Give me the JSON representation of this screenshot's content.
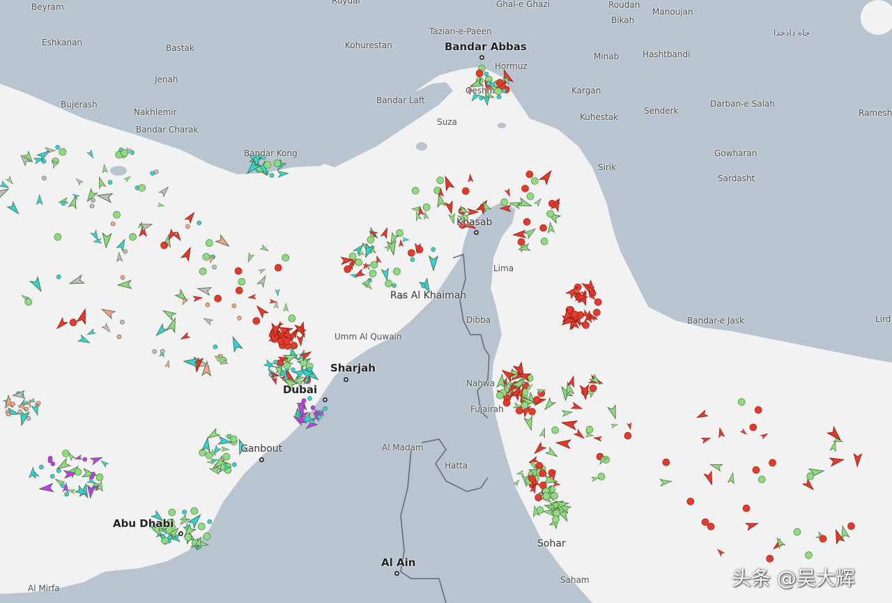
{
  "colors": {
    "sea": "#f2f2f2",
    "land": "#b8c4cf",
    "border": "#666666",
    "cargo": "#8fdc7f",
    "tanker": "#e53b2c",
    "passenger": "#1e49d6",
    "highspeed": "#e6c33a",
    "tug": "#2fd5d6",
    "pleasure": "#cc33ff",
    "unknown": "#bfbfbf",
    "other": "#f8a089"
  },
  "places": [
    {
      "name": "Beyram",
      "cls": ""
    },
    {
      "name": "Ruydar",
      "cls": ""
    },
    {
      "name": "Ghal-e Ghazi",
      "cls": ""
    },
    {
      "name": "Roudan",
      "cls": ""
    },
    {
      "name": "Manoujan",
      "cls": ""
    },
    {
      "name": "Bikah",
      "cls": ""
    },
    {
      "name": "جاه دادخدا",
      "cls": "arabic"
    },
    {
      "name": "Eshkanan",
      "cls": ""
    },
    {
      "name": "Bastak",
      "cls": ""
    },
    {
      "name": "Kohurestan",
      "cls": ""
    },
    {
      "name": "Tazian-e-Paeen",
      "cls": ""
    },
    {
      "name": "Bandar Abbas",
      "cls": "big"
    },
    {
      "name": "Hormuz",
      "cls": ""
    },
    {
      "name": "Minab",
      "cls": ""
    },
    {
      "name": "Hashtbandi",
      "cls": ""
    },
    {
      "name": "Jenah",
      "cls": ""
    },
    {
      "name": "Qeshm",
      "cls": ""
    },
    {
      "name": "Kargan",
      "cls": ""
    },
    {
      "name": "Bujerash",
      "cls": ""
    },
    {
      "name": "Bandar Laft",
      "cls": ""
    },
    {
      "name": "Nakhlemir",
      "cls": ""
    },
    {
      "name": "Senderk",
      "cls": ""
    },
    {
      "name": "Darban-e Salah",
      "cls": ""
    },
    {
      "name": "Ramesh",
      "cls": ""
    },
    {
      "name": "Kuhestak",
      "cls": ""
    },
    {
      "name": "Suza",
      "cls": ""
    },
    {
      "name": "Bandar Charak",
      "cls": ""
    },
    {
      "name": "Bandar Kong",
      "cls": ""
    },
    {
      "name": "Gowharan",
      "cls": ""
    },
    {
      "name": "Sirik",
      "cls": ""
    },
    {
      "name": "Sardasht",
      "cls": ""
    },
    {
      "name": "Khasab",
      "cls": "med"
    },
    {
      "name": "Lima",
      "cls": ""
    },
    {
      "name": "Ras Al Khaimah",
      "cls": "med"
    },
    {
      "name": "Bandar-e Jask",
      "cls": ""
    },
    {
      "name": "Lird",
      "cls": ""
    },
    {
      "name": "Dibba",
      "cls": ""
    },
    {
      "name": "Umm Al Quwain",
      "cls": ""
    },
    {
      "name": "Sharjah",
      "cls": "big"
    },
    {
      "name": "Dubai",
      "cls": "big"
    },
    {
      "name": "Nahwa",
      "cls": ""
    },
    {
      "name": "Fujairah",
      "cls": ""
    },
    {
      "name": "Ganbout",
      "cls": "med"
    },
    {
      "name": "Al Madam",
      "cls": ""
    },
    {
      "name": "Hatta",
      "cls": ""
    },
    {
      "name": "Abu Dhabi",
      "cls": "big"
    },
    {
      "name": "Sohar",
      "cls": "med"
    },
    {
      "name": "Al Ain",
      "cls": "big"
    },
    {
      "name": "Saham",
      "cls": ""
    },
    {
      "name": "Al Mirfa",
      "cls": ""
    }
  ],
  "watermark": "头条 @吴大辉"
}
